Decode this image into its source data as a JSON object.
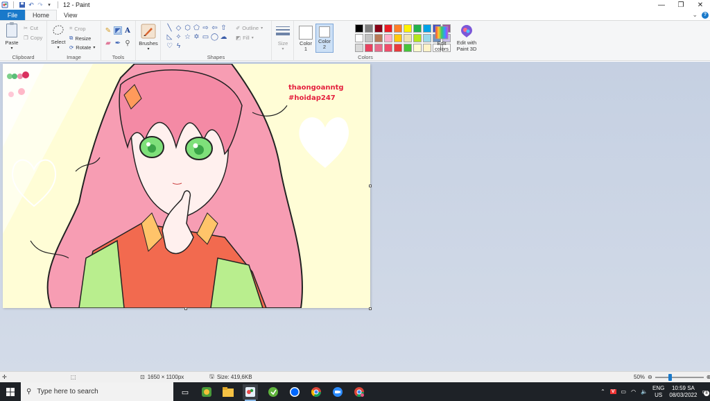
{
  "window": {
    "title": "12 - Paint",
    "controls": {
      "minimize": "—",
      "maximize": "❐",
      "close": "✕"
    }
  },
  "tabs": [
    {
      "label": "File"
    },
    {
      "label": "Home"
    },
    {
      "label": "View"
    }
  ],
  "ribbon": {
    "clipboard": {
      "label": "Clipboard",
      "paste": "Paste",
      "cut": "Cut",
      "copy": "Copy"
    },
    "image": {
      "label": "Image",
      "select": "Select",
      "crop": "Crop",
      "resize": "Resize",
      "rotate": "Rotate"
    },
    "tools": {
      "label": "Tools"
    },
    "brushes": {
      "label": "Brushes"
    },
    "shapes": {
      "label": "Shapes",
      "outline": "Outline",
      "fill": "Fill"
    },
    "size": {
      "label": "Size"
    },
    "colors": {
      "label": "Colors",
      "color1": "Color\n1",
      "color1_line1": "Color",
      "color1_line2": "1",
      "color2_line1": "Color",
      "color2_line2": "2",
      "edit_line1": "Edit",
      "edit_line2": "colors",
      "paint3d_line1": "Edit with",
      "paint3d_line2": "Paint 3D",
      "color1_value": "#ffffff",
      "color2_value": "#ffffff",
      "palette": [
        "#000000",
        "#7f7f7f",
        "#880015",
        "#ed1c24",
        "#ff7f27",
        "#fff200",
        "#22b14c",
        "#00a2e8",
        "#3f48cc",
        "#a349a4",
        "#ffffff",
        "#c3c3c3",
        "#b97a57",
        "#ffaec9",
        "#ffc90e",
        "#efe4b0",
        "#b5e61d",
        "#99d9ea",
        "#7092be",
        "#c8bfe7",
        "#d9d9d9",
        "#e8415f",
        "#e86a8a",
        "#f04d6a",
        "#e83b3b",
        "#47c43a",
        "#fffbd0",
        "#fff3c8",
        "#ffffff",
        "#ffffff"
      ]
    }
  },
  "canvas": {
    "artist_line1": "thaongoanntg",
    "artist_line2": "#hoidap247",
    "background": "#fffdd6"
  },
  "status": {
    "dimensions": "1650 × 1100px",
    "size": "Size: 419,6KB",
    "zoom": "50%",
    "zoom_fraction": 0.5
  },
  "taskbar": {
    "search_placeholder": "Type here to search",
    "lang_line1": "ENG",
    "lang_line2": "US",
    "time": "10:59 SA",
    "date": "08/03/2022",
    "notification_count": "8"
  }
}
